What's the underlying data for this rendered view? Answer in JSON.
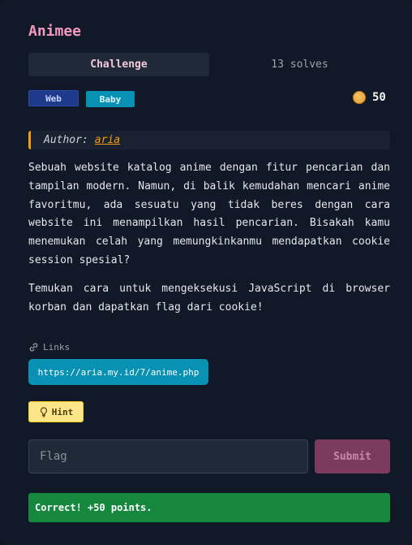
{
  "challenge": {
    "title": "Animee",
    "tabs": [
      {
        "label": "Challenge",
        "active": true
      },
      {
        "label": "13 solves",
        "active": false
      }
    ],
    "tags": [
      "Web",
      "Baby"
    ],
    "points": "50",
    "author_prefix": "Author:",
    "author": "aria",
    "description": [
      "Sebuah website katalog anime dengan fitur pencarian dan tampilan modern. Namun, di balik kemudahan mencari anime favoritmu, ada sesuatu yang tidak beres dengan cara website ini menampilkan hasil pencarian. Bisakah kamu menemukan celah yang memungkinkanmu mendapatkan cookie session spesial?",
      "Temukan cara untuk mengeksekusi JavaScript di browser korban dan dapatkan flag dari cookie!"
    ],
    "links_label": "Links",
    "links": [
      "https://aria.my.id/7/anime.php"
    ],
    "hint_label": "Hint",
    "flag_placeholder": "Flag",
    "flag_value": "",
    "submit_label": "Submit",
    "result_message": "Correct! +50 points."
  },
  "colors": {
    "background": "#111827",
    "title": "#f49ac1",
    "accent_orange": "#f59e0b",
    "link_button": "#0891b2",
    "success": "#15883e",
    "submit_disabled": "#7c3a5f"
  },
  "icons": {
    "points": "coin-icon",
    "links": "link-icon",
    "hint": "lightbulb-icon"
  }
}
